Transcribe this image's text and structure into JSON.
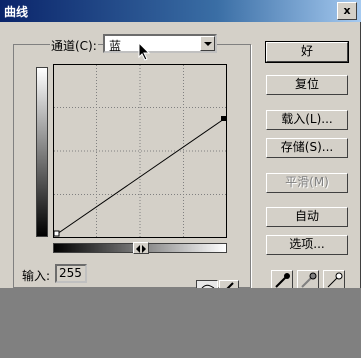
{
  "dialog": {
    "title": "曲线",
    "close_glyph": "x"
  },
  "channel": {
    "label": "通道(C):",
    "value": "蓝"
  },
  "input": {
    "label": "输入:",
    "value": "255"
  },
  "buttons": {
    "ok": "好",
    "reset": "复位",
    "load": "载入(L)...",
    "save": "存储(S)...",
    "smooth": "平滑(M)",
    "auto": "自动",
    "options": "选项..."
  },
  "curve": {
    "start": {
      "input": 0,
      "output": 0
    },
    "end": {
      "input": 255,
      "output": 255
    }
  },
  "icons": [
    "close-icon",
    "dropdown-arrow-icon",
    "curve-tool-icon",
    "pencil-tool-icon",
    "black-eyedropper-icon",
    "gray-eyedropper-icon",
    "white-eyedropper-icon",
    "arrow-cursor-icon"
  ],
  "colors": {
    "title_start": "#0a246a",
    "title_end": "#a6caf0",
    "dialog_bg": "#d4d0c8"
  }
}
